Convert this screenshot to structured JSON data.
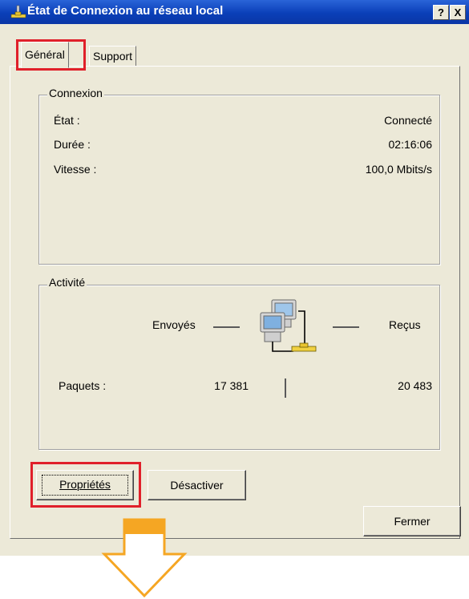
{
  "window": {
    "title": "État de Connexion au réseau local",
    "help_button": "?",
    "close_button": "X"
  },
  "tabs": [
    {
      "label": "Général",
      "active": true
    },
    {
      "label": "Support",
      "active": false
    }
  ],
  "connexion": {
    "legend": "Connexion",
    "rows": [
      {
        "label": "État :",
        "value": "Connecté"
      },
      {
        "label": "Durée :",
        "value": "02:16:06"
      },
      {
        "label": "Vitesse :",
        "value": "100,0 Mbits/s"
      }
    ]
  },
  "activite": {
    "legend": "Activité",
    "sent_label": "Envoyés",
    "received_label": "Reçus",
    "packets_label": "Paquets :",
    "packets_sent": "17 381",
    "packets_received": "20 483"
  },
  "buttons": {
    "properties": "Propriétés",
    "disable": "Désactiver",
    "close": "Fermer"
  },
  "colors": {
    "highlight": "#e0202a",
    "arrow": "#f5a623",
    "titlebar": "#0a3fb8",
    "face": "#ece9d8"
  },
  "icons": {
    "title": "network-connection-icon",
    "activity": "network-computers-icon",
    "annotation": "down-arrow-icon"
  }
}
